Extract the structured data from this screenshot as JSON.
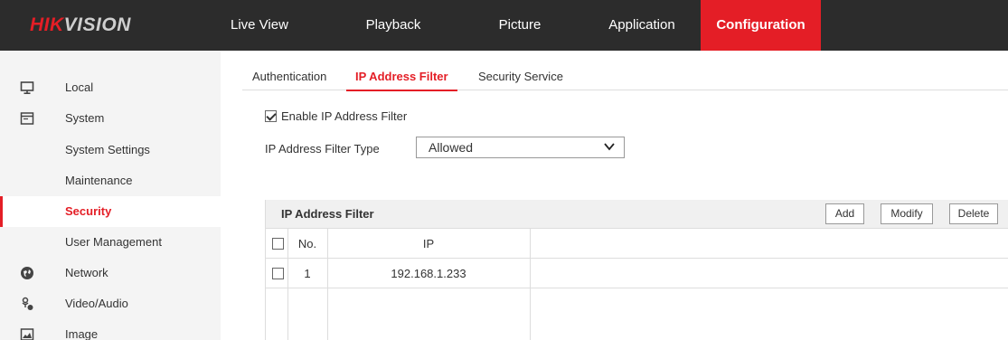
{
  "logo": {
    "part1": "HIK",
    "part2": "VISION"
  },
  "nav": [
    {
      "label": "Live View"
    },
    {
      "label": "Playback"
    },
    {
      "label": "Picture"
    },
    {
      "label": "Application"
    },
    {
      "label": "Configuration",
      "active": true
    }
  ],
  "sidebar": {
    "items": [
      {
        "label": "Local",
        "icon": "monitor-icon"
      },
      {
        "label": "System",
        "icon": "system-window-icon"
      },
      {
        "label": "System Settings"
      },
      {
        "label": "Maintenance"
      },
      {
        "label": "Security",
        "active": true
      },
      {
        "label": "User Management"
      },
      {
        "label": "Network",
        "icon": "globe-icon"
      },
      {
        "label": "Video/Audio",
        "icon": "video-audio-icon"
      },
      {
        "label": "Image",
        "icon": "image-icon"
      }
    ]
  },
  "tabs": [
    {
      "label": "Authentication"
    },
    {
      "label": "IP Address Filter",
      "active": true
    },
    {
      "label": "Security Service"
    }
  ],
  "form": {
    "enable_label": "Enable IP Address Filter",
    "enable_checked": true,
    "type_label": "IP Address Filter Type",
    "type_value": "Allowed"
  },
  "table": {
    "title": "IP Address Filter",
    "buttons": {
      "add": "Add",
      "modify": "Modify",
      "delete": "Delete"
    },
    "columns": {
      "no": "No.",
      "ip": "IP"
    },
    "rows": [
      {
        "no": "1",
        "ip": "192.168.1.233"
      }
    ]
  },
  "colors": {
    "accent": "#e41e26",
    "topbar": "#2c2c2c",
    "sidebar": "#f4f4f4"
  }
}
